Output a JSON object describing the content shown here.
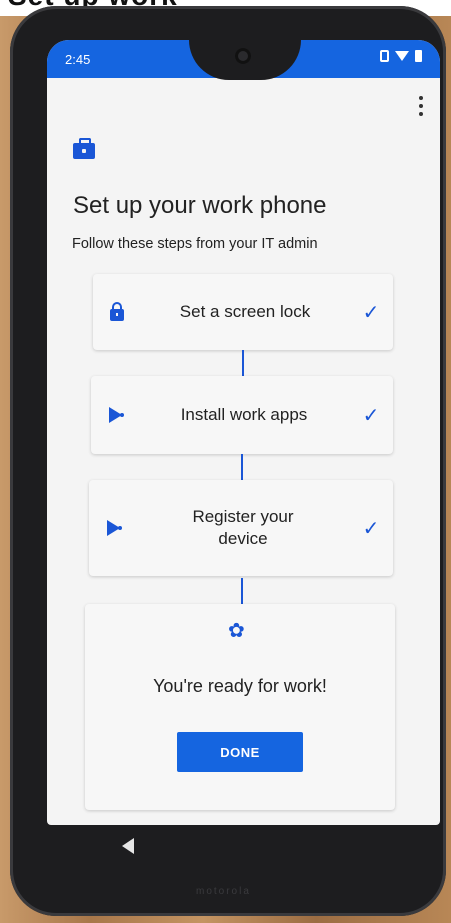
{
  "caption": {
    "text": "Set up work"
  },
  "status": {
    "time": "2:45"
  },
  "header": {
    "title": "Set up your work phone",
    "subtitle": "Follow these steps from your IT admin"
  },
  "steps": [
    {
      "label": "Set a screen lock",
      "icon": "lock-icon",
      "done": true,
      "check": "✓"
    },
    {
      "label": "Install work apps",
      "icon": "play-store-icon",
      "done": true,
      "check": "✓"
    },
    {
      "label": "Register your device",
      "icon": "play-store-icon",
      "done": true,
      "check": "✓"
    }
  ],
  "final": {
    "icon": "party-popper-icon",
    "message": "You're ready for work!",
    "done_label": "DONE"
  },
  "device": {
    "brand": "motorola"
  },
  "colors": {
    "accent": "#1565e0",
    "icon_blue": "#1a56d6",
    "background": "#f4f4f4"
  }
}
